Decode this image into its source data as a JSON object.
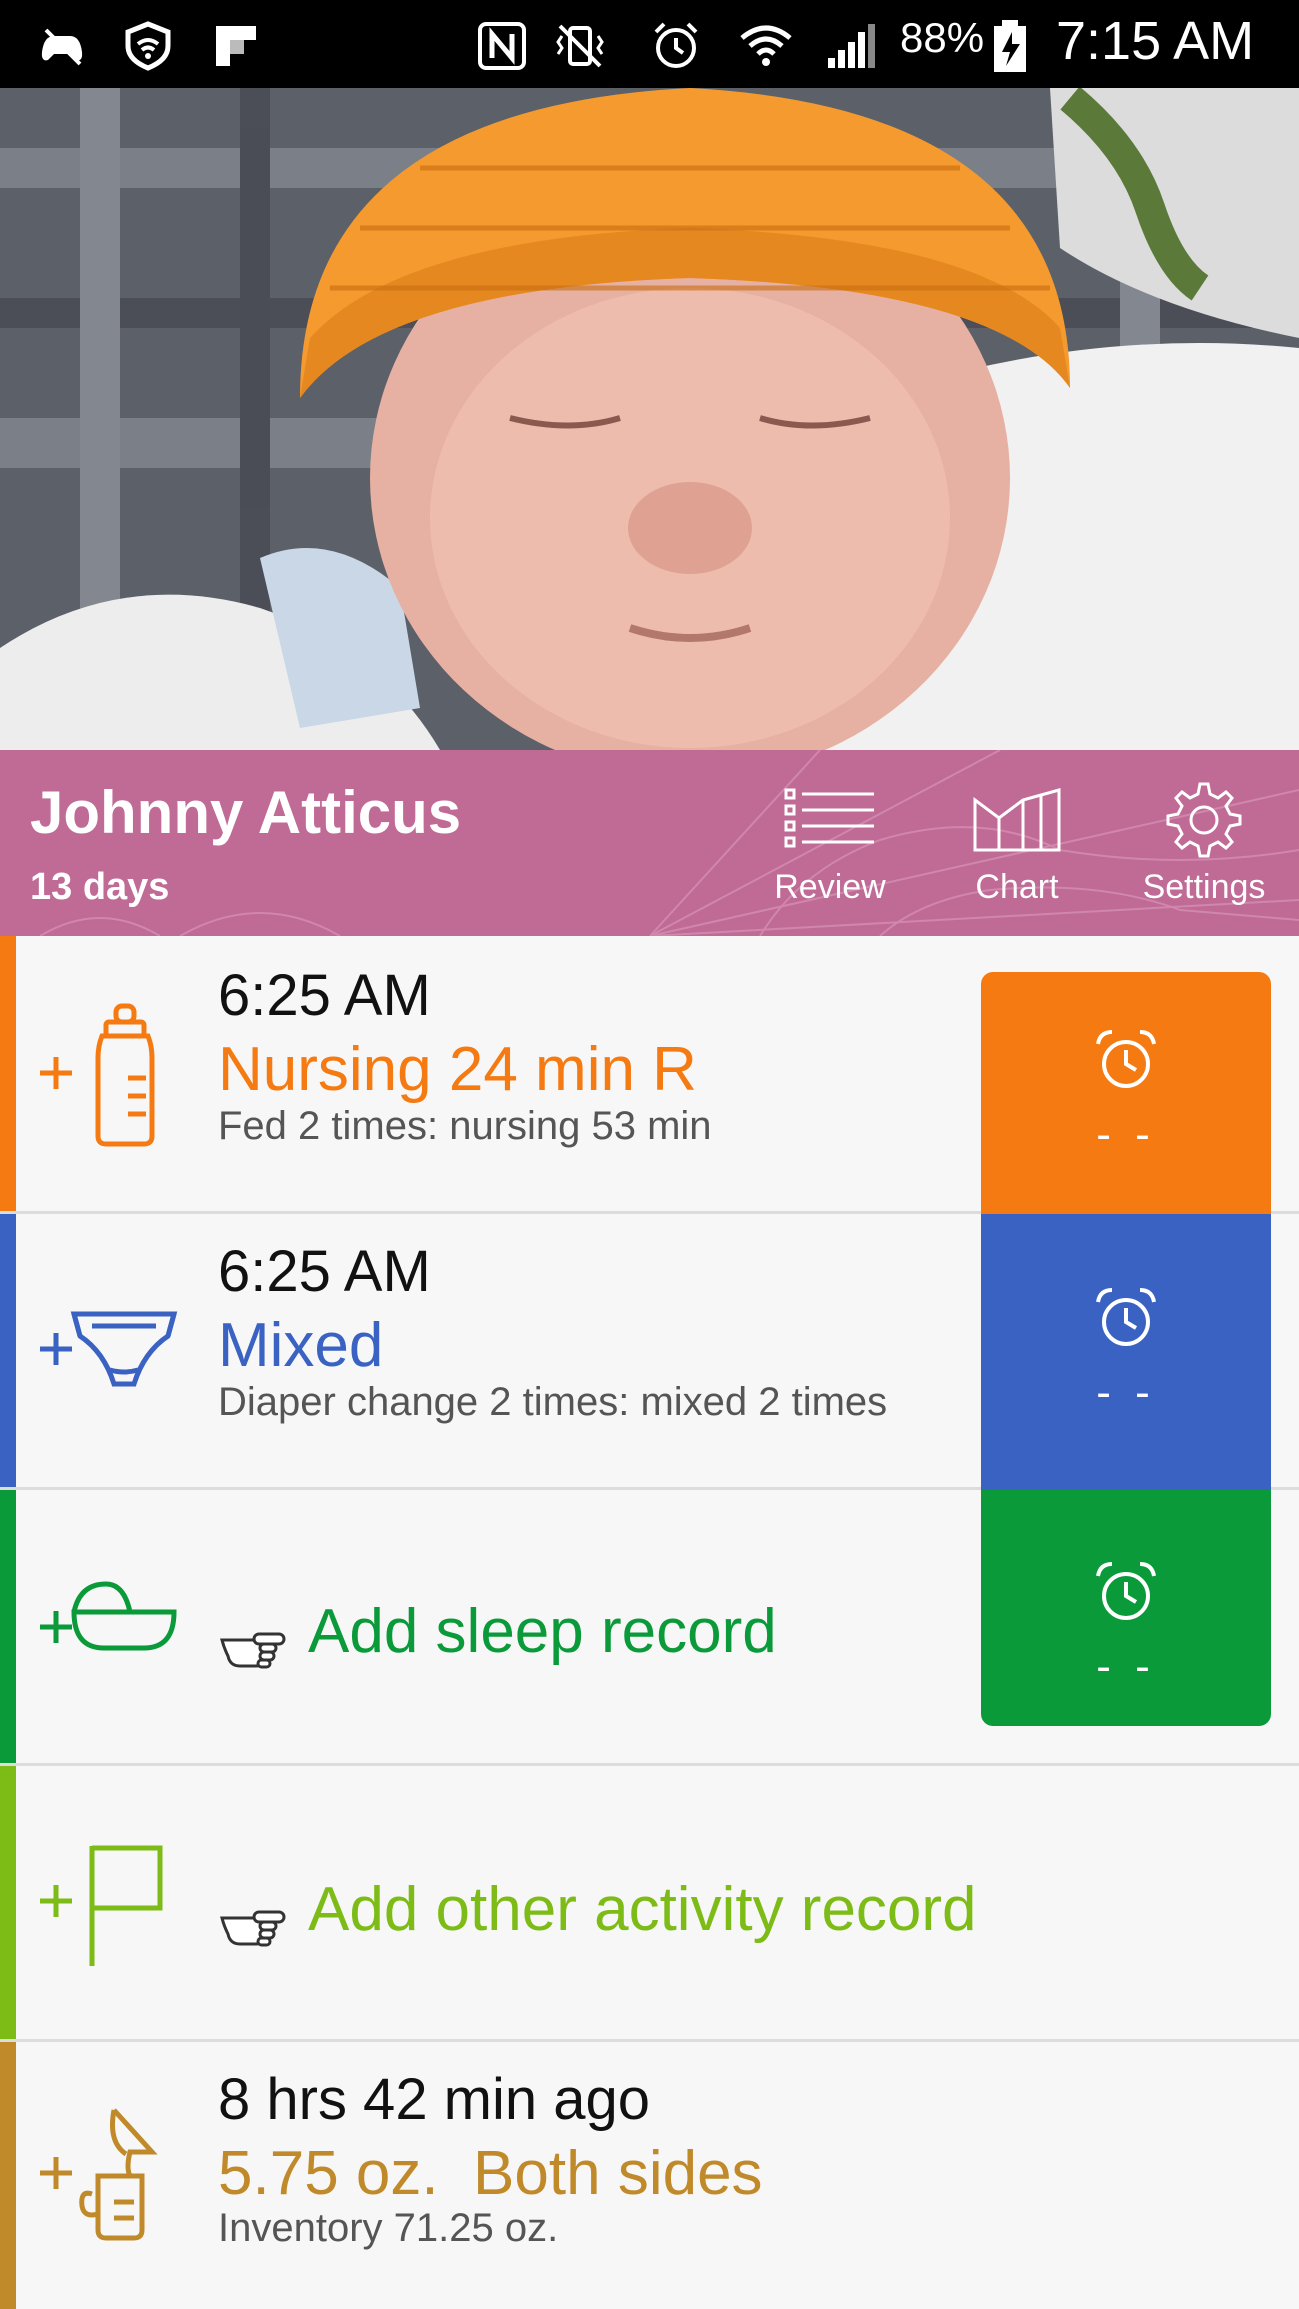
{
  "status_bar": {
    "icons": [
      "gamepad-icon",
      "shield-wifi-icon",
      "flipboard-icon",
      "nfc-icon",
      "vibrate-mute-icon",
      "alarm-icon",
      "wifi-icon",
      "signal-icon"
    ],
    "battery": "88%",
    "time": "7:15 AM"
  },
  "profile": {
    "name": "Johnny Atticus",
    "age": "13 days",
    "buttons": [
      {
        "label": "Review",
        "icon": "list-icon"
      },
      {
        "label": "Chart",
        "icon": "chart-icon"
      },
      {
        "label": "Settings",
        "icon": "gear-icon"
      }
    ]
  },
  "rows": {
    "feeding": {
      "icon": "bottle-icon",
      "color": "#f57a12",
      "time": "6:25 AM",
      "main": "Nursing 24 min R",
      "sub": "Fed 2 times: nursing 53 min",
      "timer": "- -"
    },
    "diaper": {
      "icon": "diaper-icon",
      "color": "#3a62c2",
      "time": "6:25 AM",
      "main": "Mixed",
      "sub": "Diaper change 2 times: mixed 2 times",
      "timer": "- -"
    },
    "sleep": {
      "icon": "bassinet-icon",
      "color": "#0a9a3a",
      "add": "Add sleep record",
      "timer": "- -"
    },
    "other": {
      "icon": "flag-icon",
      "color": "#7dbb16",
      "add": "Add other activity record"
    },
    "pump": {
      "icon": "breast-pump-icon",
      "color": "#c08a2a",
      "time": "8 hrs 42 min ago",
      "main": "5.75 oz.  Both sides",
      "sub": "Inventory 71.25 oz."
    }
  }
}
